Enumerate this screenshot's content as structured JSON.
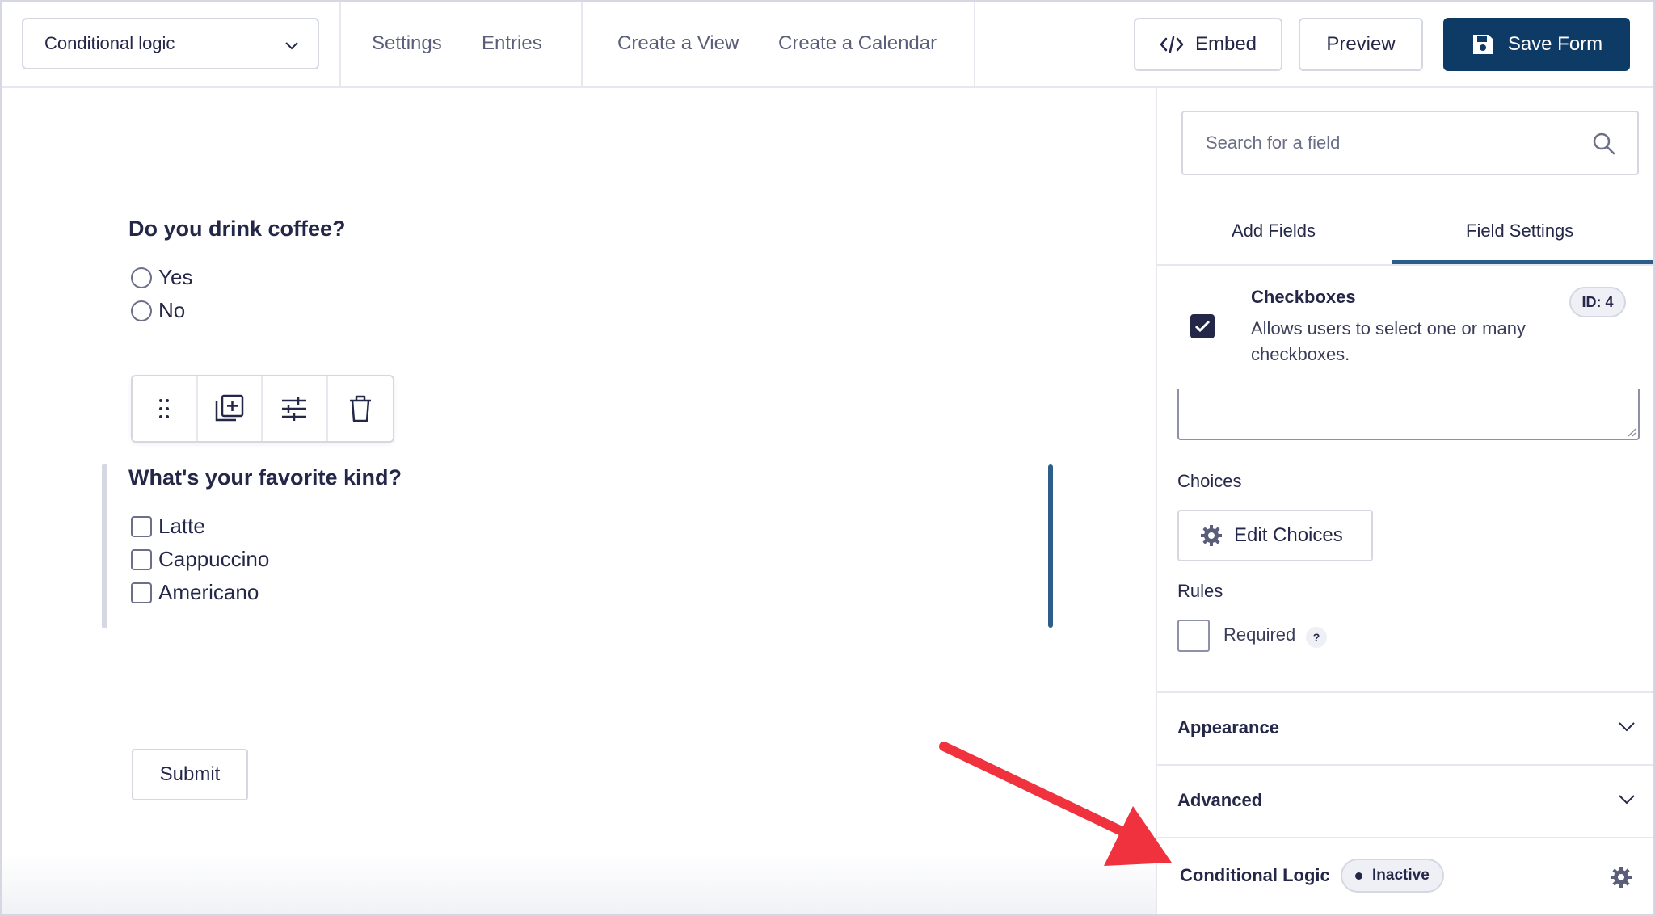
{
  "header": {
    "form_select": "Conditional logic",
    "nav": [
      "Settings",
      "Entries",
      "Create a View",
      "Create a Calendar"
    ],
    "embed_label": "Embed",
    "preview_label": "Preview",
    "save_label": "Save Form",
    "primary_color": "#0e3a66"
  },
  "canvas": {
    "q1": {
      "title": "Do you drink coffee?",
      "options": [
        "Yes",
        "No"
      ]
    },
    "toolbar_icons": [
      "drag-handle-icon",
      "duplicate-icon",
      "settings-sliders-icon",
      "trash-icon"
    ],
    "q2": {
      "title": "What's your favorite kind?",
      "options": [
        "Latte",
        "Cappuccino",
        "Americano"
      ]
    },
    "submit_label": "Submit"
  },
  "sidebar": {
    "search_placeholder": "Search for a field",
    "tabs": [
      "Add Fields",
      "Field Settings"
    ],
    "active_tab": "Field Settings",
    "field": {
      "name": "Checkboxes",
      "description": "Allows users to select one or many checkboxes.",
      "id_badge": "ID: 4"
    },
    "choices_label": "Choices",
    "edit_choices_label": "Edit Choices",
    "rules_label": "Rules",
    "required_label": "Required",
    "help_label": "?",
    "sections": [
      "Appearance",
      "Advanced"
    ],
    "conditional_logic": {
      "title": "Conditional Logic",
      "status": "Inactive"
    }
  },
  "annotation": {
    "arrow_color": "#f0323f"
  }
}
